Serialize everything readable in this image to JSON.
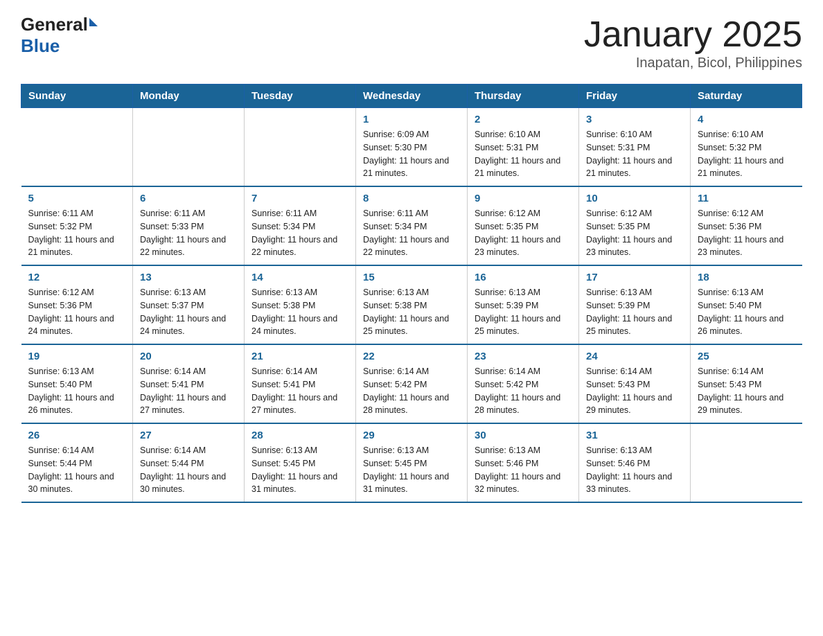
{
  "header": {
    "logo_general": "General",
    "logo_blue": "Blue",
    "title": "January 2025",
    "subtitle": "Inapatan, Bicol, Philippines"
  },
  "days_of_week": [
    "Sunday",
    "Monday",
    "Tuesday",
    "Wednesday",
    "Thursday",
    "Friday",
    "Saturday"
  ],
  "weeks": [
    [
      {
        "day": "",
        "info": ""
      },
      {
        "day": "",
        "info": ""
      },
      {
        "day": "",
        "info": ""
      },
      {
        "day": "1",
        "info": "Sunrise: 6:09 AM\nSunset: 5:30 PM\nDaylight: 11 hours and 21 minutes."
      },
      {
        "day": "2",
        "info": "Sunrise: 6:10 AM\nSunset: 5:31 PM\nDaylight: 11 hours and 21 minutes."
      },
      {
        "day": "3",
        "info": "Sunrise: 6:10 AM\nSunset: 5:31 PM\nDaylight: 11 hours and 21 minutes."
      },
      {
        "day": "4",
        "info": "Sunrise: 6:10 AM\nSunset: 5:32 PM\nDaylight: 11 hours and 21 minutes."
      }
    ],
    [
      {
        "day": "5",
        "info": "Sunrise: 6:11 AM\nSunset: 5:32 PM\nDaylight: 11 hours and 21 minutes."
      },
      {
        "day": "6",
        "info": "Sunrise: 6:11 AM\nSunset: 5:33 PM\nDaylight: 11 hours and 22 minutes."
      },
      {
        "day": "7",
        "info": "Sunrise: 6:11 AM\nSunset: 5:34 PM\nDaylight: 11 hours and 22 minutes."
      },
      {
        "day": "8",
        "info": "Sunrise: 6:11 AM\nSunset: 5:34 PM\nDaylight: 11 hours and 22 minutes."
      },
      {
        "day": "9",
        "info": "Sunrise: 6:12 AM\nSunset: 5:35 PM\nDaylight: 11 hours and 23 minutes."
      },
      {
        "day": "10",
        "info": "Sunrise: 6:12 AM\nSunset: 5:35 PM\nDaylight: 11 hours and 23 minutes."
      },
      {
        "day": "11",
        "info": "Sunrise: 6:12 AM\nSunset: 5:36 PM\nDaylight: 11 hours and 23 minutes."
      }
    ],
    [
      {
        "day": "12",
        "info": "Sunrise: 6:12 AM\nSunset: 5:36 PM\nDaylight: 11 hours and 24 minutes."
      },
      {
        "day": "13",
        "info": "Sunrise: 6:13 AM\nSunset: 5:37 PM\nDaylight: 11 hours and 24 minutes."
      },
      {
        "day": "14",
        "info": "Sunrise: 6:13 AM\nSunset: 5:38 PM\nDaylight: 11 hours and 24 minutes."
      },
      {
        "day": "15",
        "info": "Sunrise: 6:13 AM\nSunset: 5:38 PM\nDaylight: 11 hours and 25 minutes."
      },
      {
        "day": "16",
        "info": "Sunrise: 6:13 AM\nSunset: 5:39 PM\nDaylight: 11 hours and 25 minutes."
      },
      {
        "day": "17",
        "info": "Sunrise: 6:13 AM\nSunset: 5:39 PM\nDaylight: 11 hours and 25 minutes."
      },
      {
        "day": "18",
        "info": "Sunrise: 6:13 AM\nSunset: 5:40 PM\nDaylight: 11 hours and 26 minutes."
      }
    ],
    [
      {
        "day": "19",
        "info": "Sunrise: 6:13 AM\nSunset: 5:40 PM\nDaylight: 11 hours and 26 minutes."
      },
      {
        "day": "20",
        "info": "Sunrise: 6:14 AM\nSunset: 5:41 PM\nDaylight: 11 hours and 27 minutes."
      },
      {
        "day": "21",
        "info": "Sunrise: 6:14 AM\nSunset: 5:41 PM\nDaylight: 11 hours and 27 minutes."
      },
      {
        "day": "22",
        "info": "Sunrise: 6:14 AM\nSunset: 5:42 PM\nDaylight: 11 hours and 28 minutes."
      },
      {
        "day": "23",
        "info": "Sunrise: 6:14 AM\nSunset: 5:42 PM\nDaylight: 11 hours and 28 minutes."
      },
      {
        "day": "24",
        "info": "Sunrise: 6:14 AM\nSunset: 5:43 PM\nDaylight: 11 hours and 29 minutes."
      },
      {
        "day": "25",
        "info": "Sunrise: 6:14 AM\nSunset: 5:43 PM\nDaylight: 11 hours and 29 minutes."
      }
    ],
    [
      {
        "day": "26",
        "info": "Sunrise: 6:14 AM\nSunset: 5:44 PM\nDaylight: 11 hours and 30 minutes."
      },
      {
        "day": "27",
        "info": "Sunrise: 6:14 AM\nSunset: 5:44 PM\nDaylight: 11 hours and 30 minutes."
      },
      {
        "day": "28",
        "info": "Sunrise: 6:13 AM\nSunset: 5:45 PM\nDaylight: 11 hours and 31 minutes."
      },
      {
        "day": "29",
        "info": "Sunrise: 6:13 AM\nSunset: 5:45 PM\nDaylight: 11 hours and 31 minutes."
      },
      {
        "day": "30",
        "info": "Sunrise: 6:13 AM\nSunset: 5:46 PM\nDaylight: 11 hours and 32 minutes."
      },
      {
        "day": "31",
        "info": "Sunrise: 6:13 AM\nSunset: 5:46 PM\nDaylight: 11 hours and 33 minutes."
      },
      {
        "day": "",
        "info": ""
      }
    ]
  ]
}
